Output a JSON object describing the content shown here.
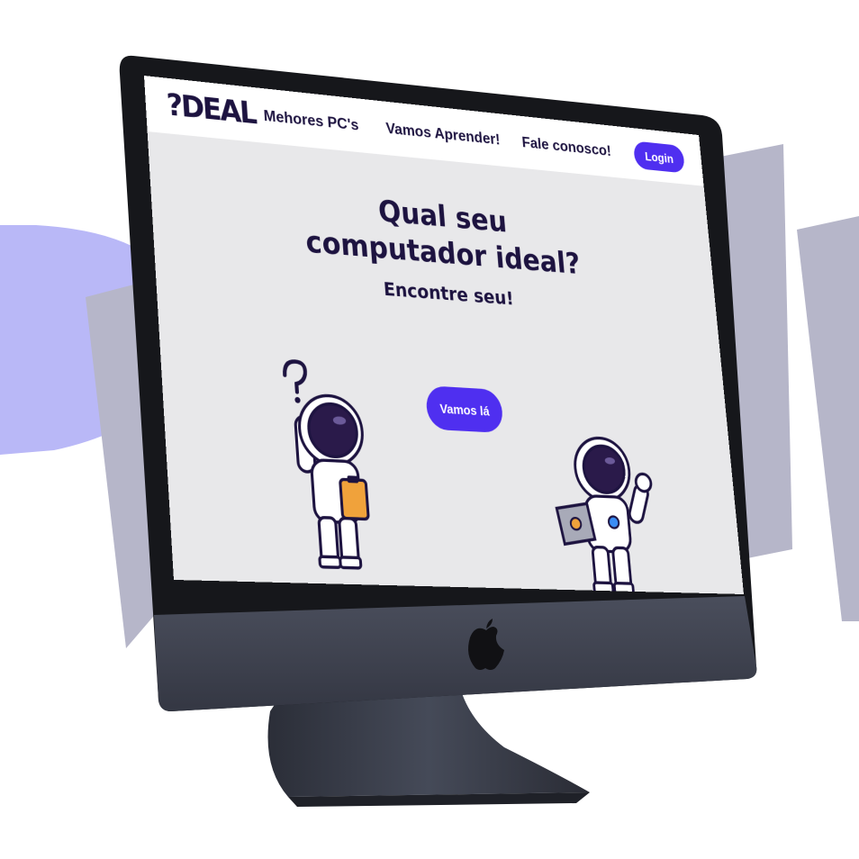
{
  "nav": {
    "logo": "?DEAL",
    "links": [
      "Mehores PC's",
      "Vamos Aprender!",
      "Fale conosco!"
    ],
    "login_label": "Login"
  },
  "hero": {
    "title_line1": "Qual seu",
    "title_line2": "computador ideal?",
    "subtitle": "Encontre seu!",
    "cta_label": "Vamos lá"
  },
  "colors": {
    "accent": "#4f2ff0",
    "text_dark": "#1d1340",
    "screen_bg": "#e8e8ea",
    "bg_shape_light": "#b9b8f7",
    "bg_shape_gray": "#b6b6c9",
    "monitor_body": "#3a3d49"
  },
  "icons": [
    "apple-logo-icon",
    "astronaut-clipboard-illustration",
    "astronaut-laptop-illustration"
  ]
}
